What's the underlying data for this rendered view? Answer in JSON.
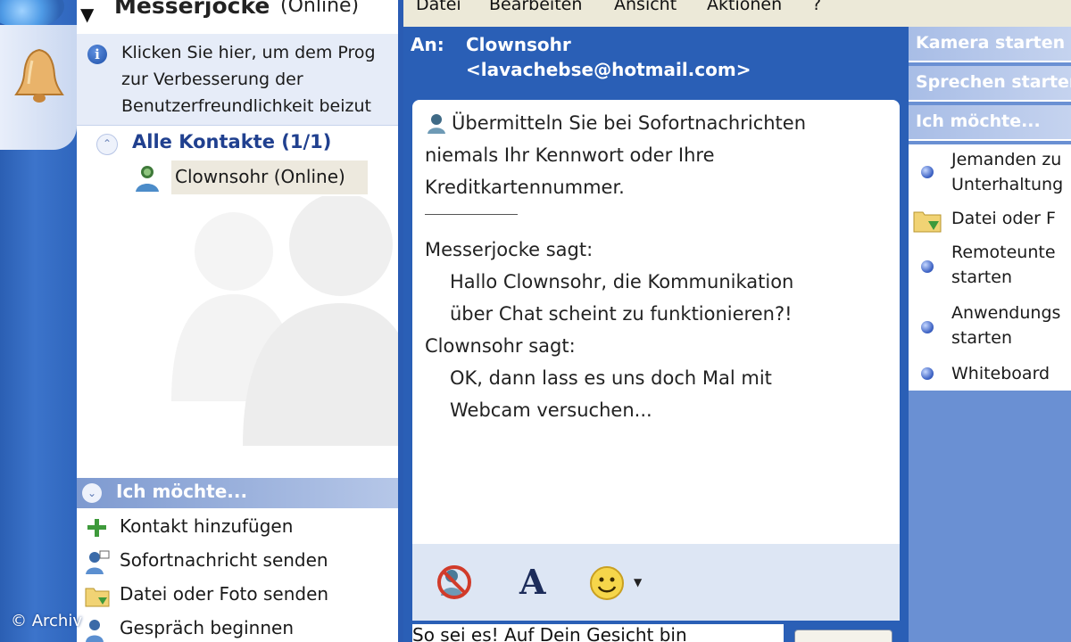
{
  "watermark": "© Archiv",
  "contacts": {
    "user_name": "Messerjocke",
    "user_status": "(Online)",
    "info_lines": [
      "Klicken Sie hier, um dem Prog",
      "zur Verbesserung der",
      "Benutzerfreundlichkeit beizut"
    ],
    "group_label": "Alle Kontakte (1/1)",
    "contact_label": "Clownsohr (Online)",
    "ich_label": "Ich möchte...",
    "tasks": [
      "Kontakt hinzufügen",
      "Sofortnachricht senden",
      "Datei oder Foto senden",
      "Gespräch beginnen"
    ]
  },
  "conversation": {
    "menu": [
      "Datei",
      "Bearbeiten",
      "Ansicht",
      "Aktionen",
      "?"
    ],
    "to_label": "An:",
    "to_name": "Clownsohr",
    "to_email": "<lavachebse@hotmail.com>",
    "warning_lines": [
      "Übermitteln Sie bei Sofortnachrichten",
      "niemals Ihr Kennwort oder Ihre",
      "Kreditkartennummer."
    ],
    "messages": [
      {
        "sender": "Messerjocke sagt:",
        "lines": [
          "Hallo Clownsohr, die Kommunikation",
          "über Chat scheint zu funktionieren?!"
        ]
      },
      {
        "sender": "Clownsohr sagt:",
        "lines": [
          "OK, dann lass es uns doch Mal mit",
          "Webcam versuchen..."
        ]
      }
    ],
    "input_text": "So sei es! Auf Dein Gesicht bin"
  },
  "sidebar": {
    "buttons": [
      "Kamera starten",
      "Sprechen starten",
      "Ich möchte..."
    ],
    "items": [
      {
        "lines": [
          "Jemanden zu",
          "Unterhaltung"
        ]
      },
      {
        "lines": [
          "Datei oder F"
        ]
      },
      {
        "lines": [
          "Remoteunte",
          "starten"
        ]
      },
      {
        "lines": [
          "Anwendungs",
          "starten"
        ]
      },
      {
        "lines": [
          "Whiteboard"
        ]
      }
    ]
  },
  "colors": {
    "window_blue": "#2a5fb6",
    "menu_bar": "#ece9d8",
    "info_bar": "#e6ecf8",
    "group_text": "#20408f",
    "sidebar_blue": "#6a90d3"
  },
  "icons": {
    "bell": "bell-icon",
    "info": "info-icon",
    "buddy": "buddy-icon",
    "add": "plus-icon",
    "message": "message-icon",
    "folder": "folder-icon",
    "talk": "talk-icon",
    "block": "block-icon",
    "font": "font-icon",
    "emoticon": "emoticon-icon"
  }
}
